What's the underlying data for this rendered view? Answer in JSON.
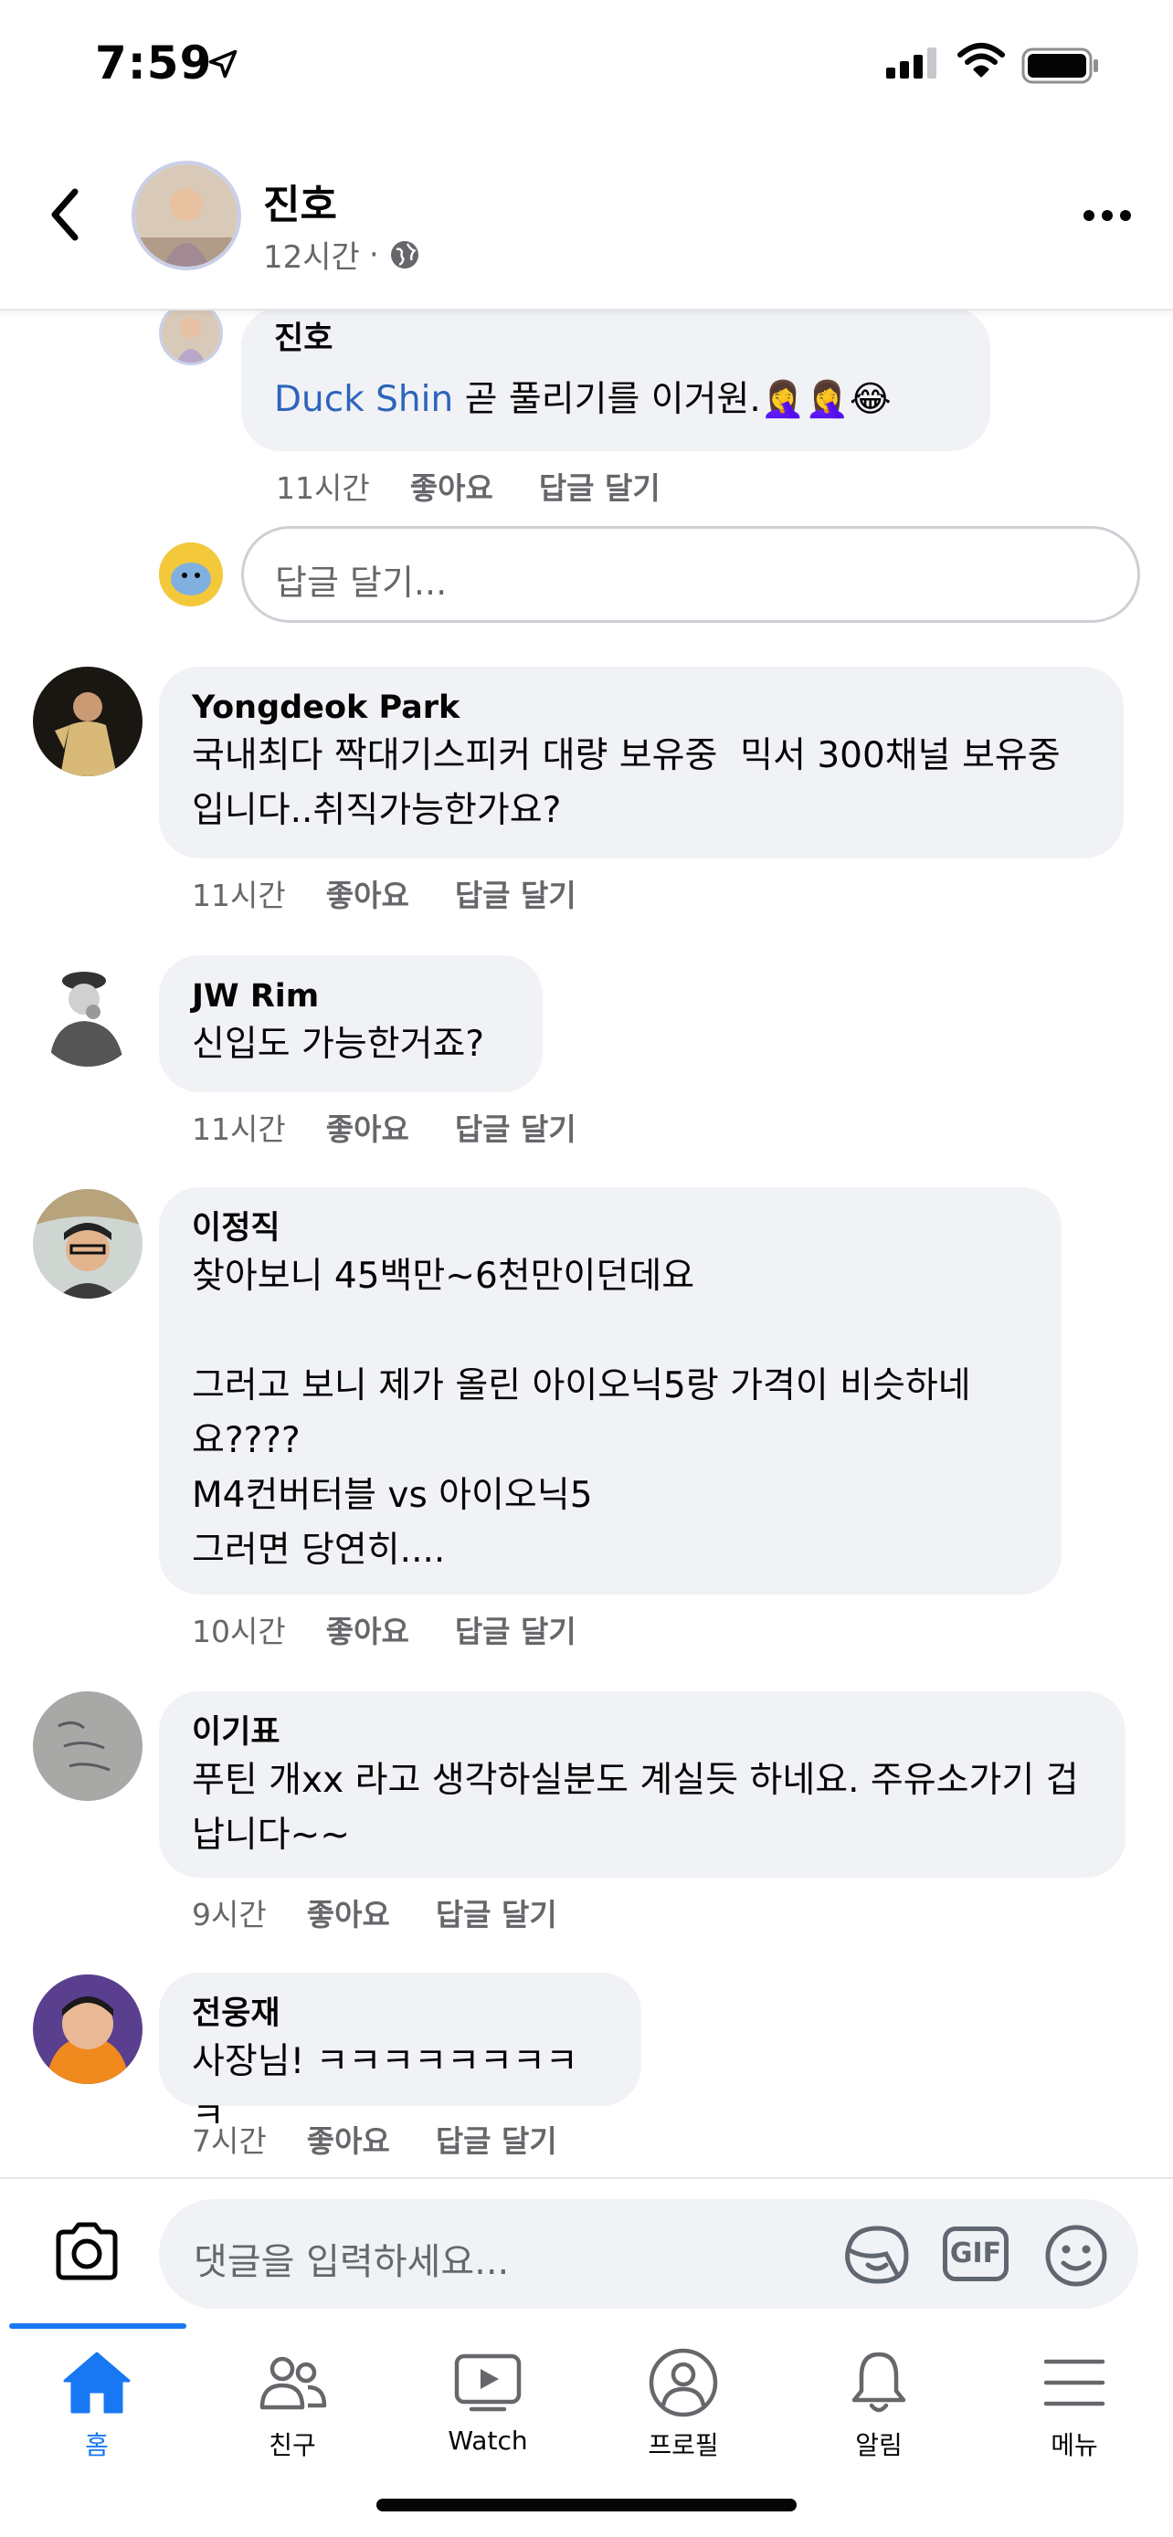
{
  "status_bar": {
    "time": "7:59"
  },
  "header": {
    "name": "진호",
    "time": "12시간",
    "separator": "·"
  },
  "reply": {
    "name": "진호",
    "mention": "Duck Shin",
    "text": " 곧 풀리기를 이거원.🤦‍♀️🤦‍♀️😂",
    "time": "11시간",
    "like": "좋아요",
    "reply": "답글 달기"
  },
  "reply_input": {
    "placeholder": "답글 달기..."
  },
  "comments": [
    {
      "name": "Yongdeok Park",
      "text": "국내최다 짝대기스피커 대량 보유중  믹서 300채널 보유중입니다..취직가능한가요?",
      "time": "11시간",
      "like": "좋아요",
      "reply": "답글 달기"
    },
    {
      "name": "JW Rim",
      "text": "신입도 가능한거죠?",
      "time": "11시간",
      "like": "좋아요",
      "reply": "답글 달기"
    },
    {
      "name": "이정직",
      "text": "찾아보니 45백만~6천만이던데요\n\n그러고 보니 제가 올린 아이오닉5랑 가격이 비슷하네요????\nM4컨버터블 vs 아이오닉5\n그러면 당연히....",
      "time": "10시간",
      "like": "좋아요",
      "reply": "답글 달기"
    },
    {
      "name": "이기표",
      "text": "푸틴 개xx 라고 생각하실분도 계실듯 하네요. 주유소가기 겁납니다~~",
      "time": "9시간",
      "like": "좋아요",
      "reply": "답글 달기"
    },
    {
      "name": "전웅재",
      "text": "사장님! ㅋㅋㅋㅋㅋㅋㅋㅋㅋ",
      "time": "7시간",
      "like": "좋아요",
      "reply": "답글 달기"
    }
  ],
  "comment_bar": {
    "placeholder": "댓글을 입력하세요...",
    "gif_label": "GIF"
  },
  "tabs": [
    {
      "label": "홈",
      "icon": "home-icon",
      "active": true
    },
    {
      "label": "친구",
      "icon": "friends-icon",
      "active": false
    },
    {
      "label": "Watch",
      "icon": "watch-icon",
      "active": false
    },
    {
      "label": "프로필",
      "icon": "profile-icon",
      "active": false
    },
    {
      "label": "알림",
      "icon": "bell-icon",
      "active": false
    },
    {
      "label": "메뉴",
      "icon": "menu-icon",
      "active": false
    }
  ],
  "colors": {
    "accent": "#1877f2",
    "mention": "#2d64bc",
    "bubble": "#f0f2f5",
    "secondary_text": "#65676b"
  }
}
